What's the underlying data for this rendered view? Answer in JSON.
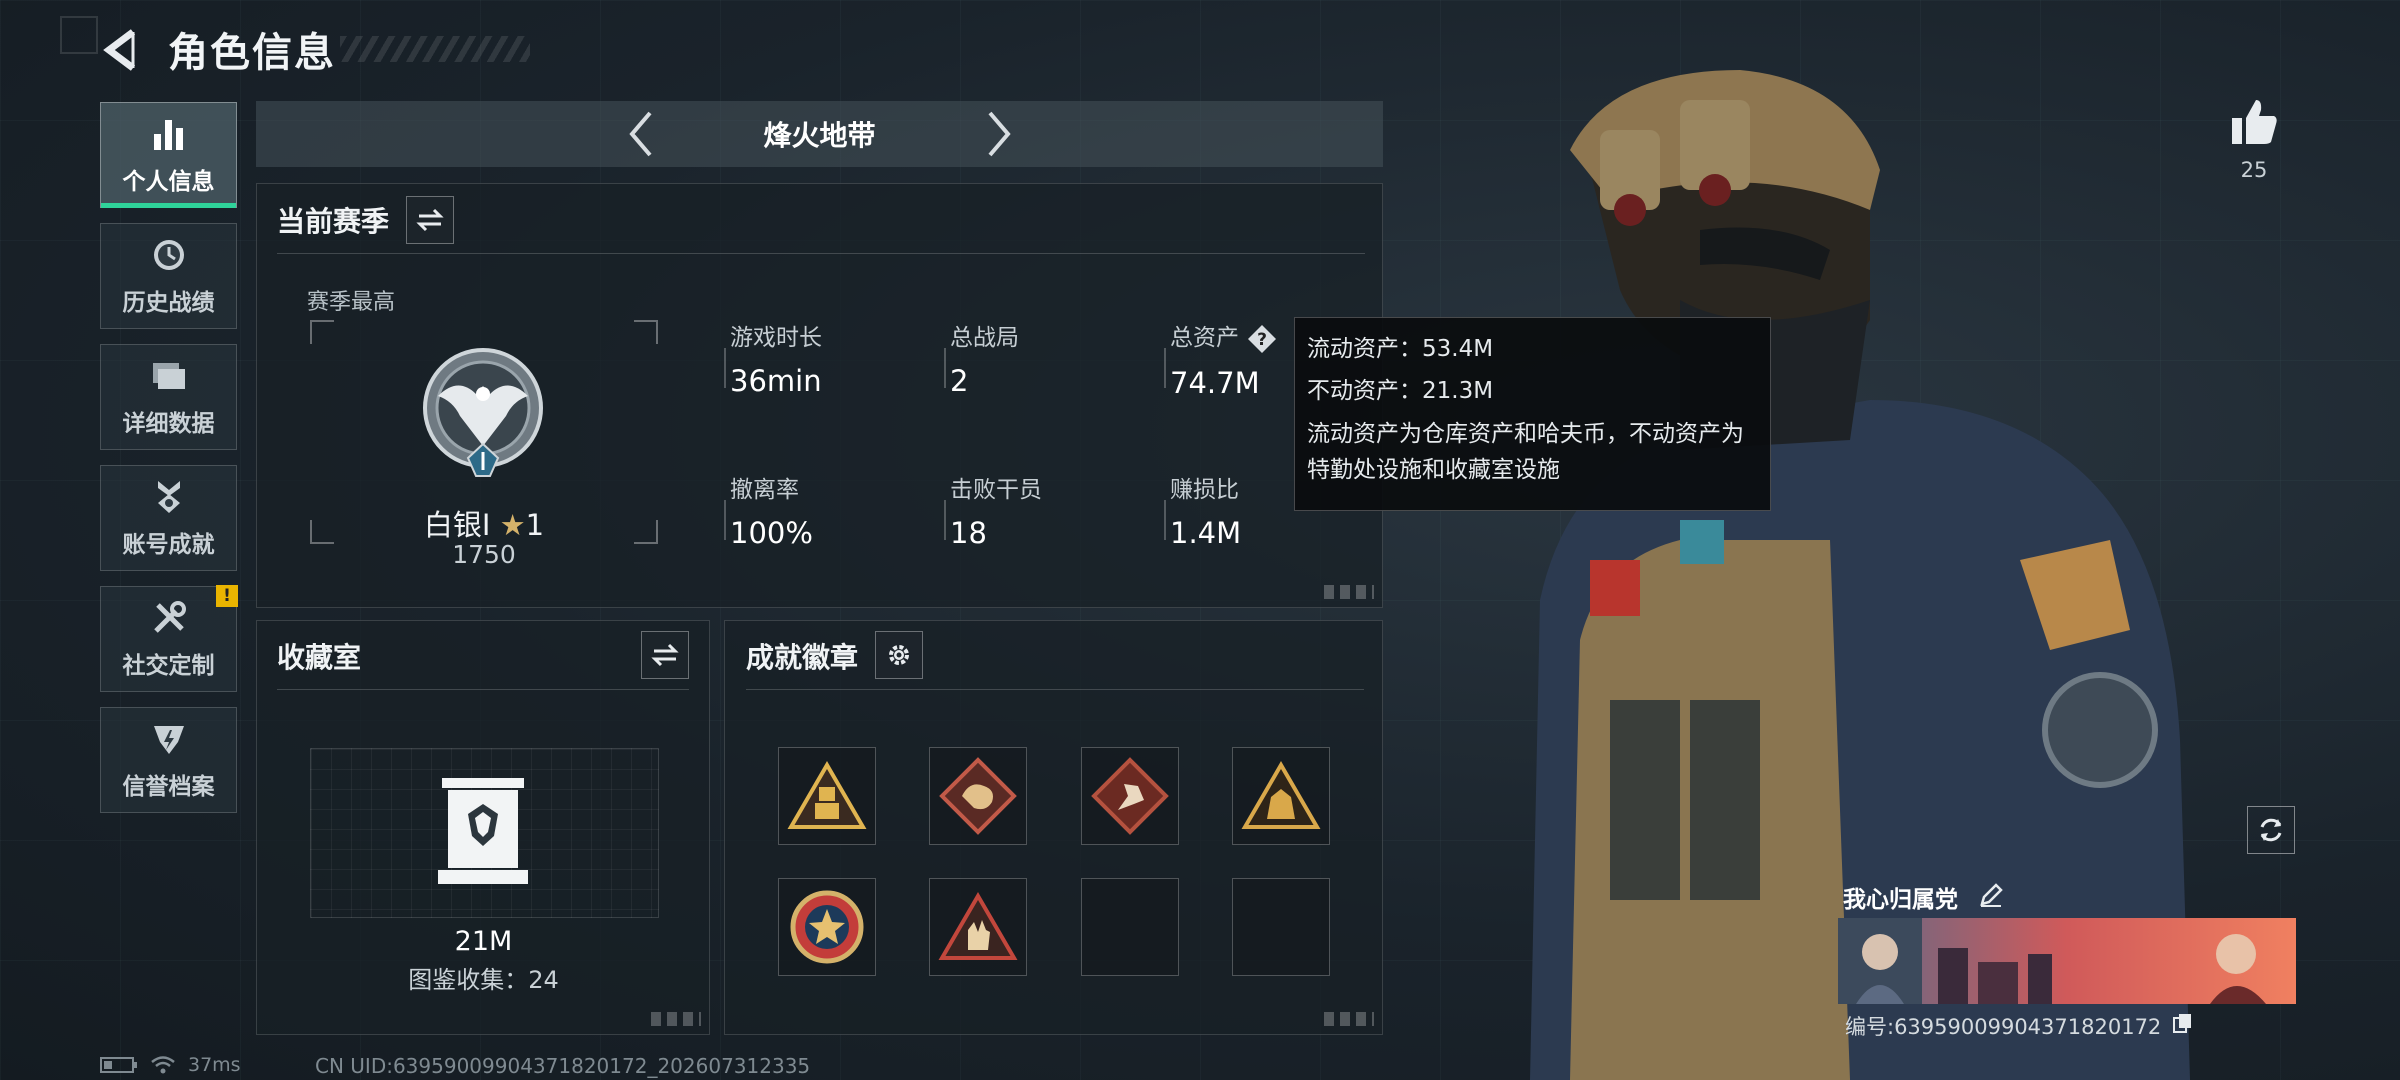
{
  "header": {
    "title": "角色信息"
  },
  "sidebar": {
    "items": [
      {
        "label": "个人信息",
        "icon": "bar-chart-icon",
        "active": true
      },
      {
        "label": "历史战绩",
        "icon": "clock-icon"
      },
      {
        "label": "详细数据",
        "icon": "folder-icon"
      },
      {
        "label": "账号成就",
        "icon": "medal-icon"
      },
      {
        "label": "社交定制",
        "icon": "tools-icon",
        "badge": "!"
      },
      {
        "label": "信誉档案",
        "icon": "shield-icon"
      }
    ]
  },
  "mode": {
    "title": "烽火地带"
  },
  "season": {
    "title": "当前赛季",
    "best_label": "赛季最高",
    "rank_name": "白银I",
    "rank_stars": "1",
    "rank_score": "1750",
    "stats": [
      {
        "label": "游戏时长",
        "value": "36min"
      },
      {
        "label": "总战局",
        "value": "2"
      },
      {
        "label": "总资产",
        "value": "74.7M"
      },
      {
        "label": "撤离率",
        "value": "100%"
      },
      {
        "label": "击败干员",
        "value": "18"
      },
      {
        "label": "赚损比",
        "value": "1.4M"
      }
    ]
  },
  "tooltip": {
    "liquid": "流动资产：53.4M",
    "fixed": "不动资产：21.3M",
    "description": "流动资产为仓库资产和哈夫币，不动资产为特勤处设施和收藏室设施"
  },
  "collection": {
    "title": "收藏室",
    "value": "21M",
    "sub": "图鉴收集：24"
  },
  "achievements": {
    "title": "成就徽章",
    "badges": [
      {
        "icon": "robot-triangle-icon",
        "color": "#e0b450"
      },
      {
        "icon": "dragon-diamond-icon",
        "color": "#c25a48"
      },
      {
        "icon": "runner-diamond-icon",
        "color": "#b5523f"
      },
      {
        "icon": "gorilla-triangle-icon",
        "color": "#d9a84a"
      },
      {
        "icon": "star-circle-icon",
        "color": "#c33d3a"
      },
      {
        "icon": "hand-triangle-icon",
        "color": "#c2473c"
      },
      {
        "icon": "empty-slot"
      },
      {
        "icon": "empty-slot"
      }
    ]
  },
  "profile": {
    "likes": "25",
    "player_name": "我心归属党",
    "player_id": "编号:639590099043718201​72"
  },
  "footer": {
    "ping": "37ms",
    "uid": "CN UID:63959009904371820172_202607312335"
  },
  "colors": {
    "accent": "#2fd39a",
    "warning": "#e9b400",
    "gold": "#d4b26a"
  }
}
